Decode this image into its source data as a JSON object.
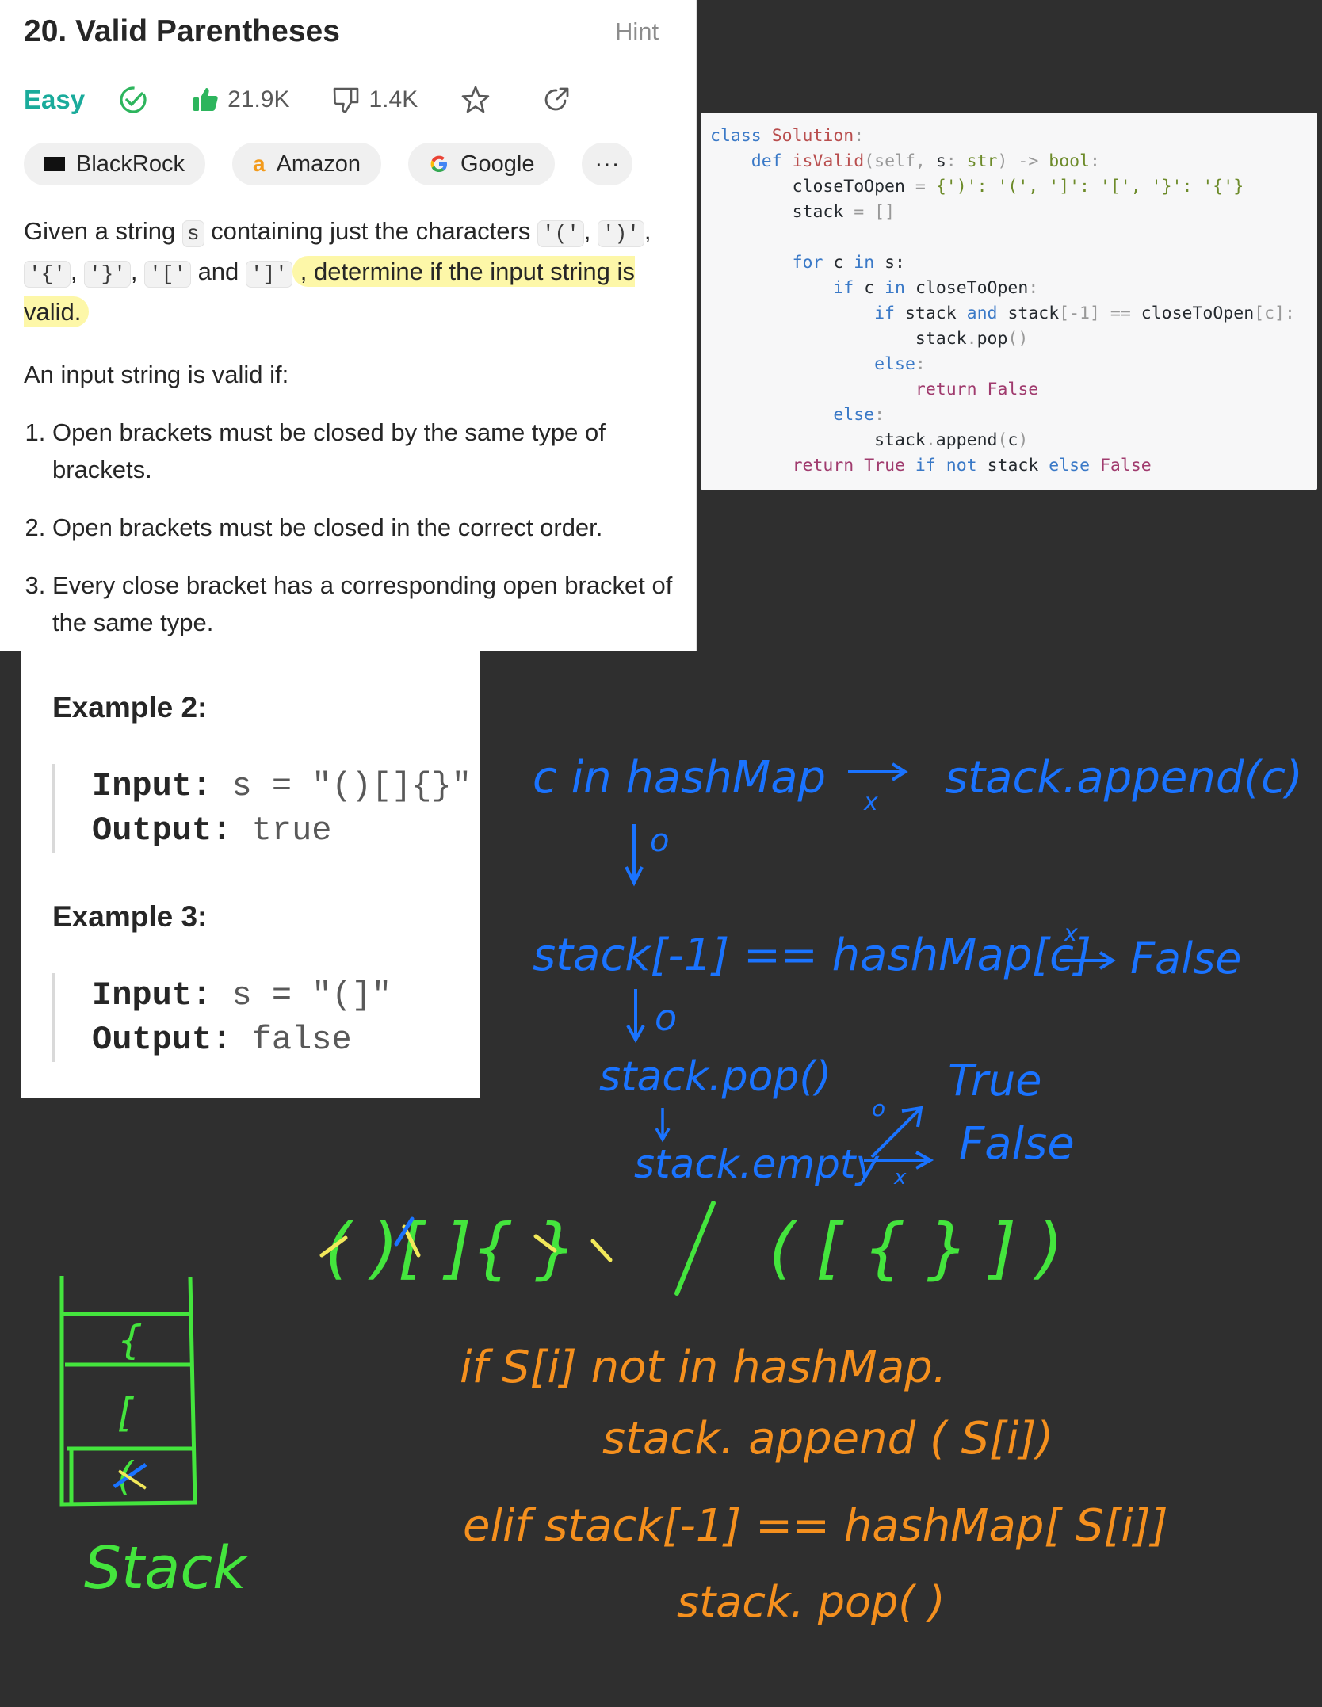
{
  "problem": {
    "title": "20. Valid Parentheses",
    "hint_label": "Hint",
    "difficulty": "Easy",
    "likes": "21.9K",
    "dislikes": "1.4K",
    "tags": [
      "BlackRock",
      "Amazon",
      "Google"
    ],
    "more_label": "···",
    "amazon_logo_letter": "a",
    "google_logo_letter": "G",
    "blackrock_logo_text": "BlackRock",
    "desc_given": "Given a string",
    "desc_s": "s",
    "desc_containing": "containing just the characters",
    "c1": "'('",
    "c2": "')'",
    "c3": "'{'",
    "c4": "'}'",
    "c5": "'['",
    "c6": "']'",
    "comma": ",",
    "and": "and",
    "desc_highlight": ", determine if the input string is valid.",
    "valid_if": "An input string is valid if:",
    "rules": [
      "Open brackets must be closed by the same type of brackets.",
      "Open brackets must be closed in the correct order.",
      "Every close bracket has a corresponding open bracket of the same type."
    ]
  },
  "examples": [
    {
      "title": "Example 2:",
      "input_label": "Input:",
      "input_value": "s = \"()[]{}\"",
      "output_label": "Output:",
      "output_value": "true"
    },
    {
      "title": "Example 3:",
      "input_label": "Input:",
      "input_value": "s = \"(]\"",
      "output_label": "Output:",
      "output_value": "false"
    }
  ],
  "code": {
    "l1a": "class",
    "l1b": "Solution",
    "l1c": ":",
    "l2a": "def",
    "l2b": "isValid",
    "l2c": "(self,",
    "l2d": "s",
    "l2e": ":",
    "l2f": "str",
    "l2g": ") ->",
    "l2h": "bool",
    "l2i": ":",
    "l3a": "closeToOpen",
    "l3b": "=",
    "l3c": "{')': '(', ']': '[', '}': '{'}",
    "l4a": "stack",
    "l4b": "=",
    "l4c": "[]",
    "l5a": "for",
    "l5b": "c",
    "l5c": "in",
    "l5d": "s:",
    "l6a": "if",
    "l6b": "c",
    "l6c": "in",
    "l6d": "closeToOpen",
    "l6e": ":",
    "l7a": "if",
    "l7b": "stack",
    "l7c": "and",
    "l7d": "stack",
    "l7e": "[-1]",
    "l7f": "==",
    "l7g": "closeToOpen",
    "l7h": "[c]:",
    "l8a": "stack",
    "l8b": ".",
    "l8c": "pop",
    "l8d": "()",
    "l9a": "else",
    "l9b": ":",
    "l10a": "return",
    "l10b": "False",
    "l11a": "else",
    "l11b": ":",
    "l12a": "stack",
    "l12b": ".",
    "l12c": "append",
    "l12d": "(",
    "l12e": "c",
    "l12f": ")",
    "l13a": "return",
    "l13b": "True",
    "l13c": "if",
    "l13d": "not",
    "l13e": "stack",
    "l13f": "else",
    "l13g": "False"
  },
  "notes": {
    "flow_1": "c in hashMap",
    "flow_1_result": "stack.append(c)",
    "x_mark": "x",
    "o_mark": "o",
    "flow_2": "stack[-1] == hashMap[c]",
    "flow_2_false": "False",
    "flow_3": "stack.pop()",
    "flow_4": "stack.empty",
    "true_label": "True",
    "false_label": "False",
    "bracket_example_left": "( )[ ]{ }",
    "slash": "/",
    "bracket_example_right": "( [ { } ] )",
    "pseudo_1": "if   S[i]  not in  hashMap.",
    "pseudo_2": "stack. append ( S[i])",
    "pseudo_3": "elif  stack[-1]  ==  hashMap[ S[i]]",
    "pseudo_4": "stack. pop(  )",
    "stack_items": [
      "{",
      "[",
      "("
    ],
    "stack_label": "Stack"
  },
  "colors": {
    "blue_ink": "#1a73ff",
    "green_ink": "#44e53d",
    "orange_ink": "#f5901e",
    "yellow_ink": "#f2e85a",
    "easy": "#1aab9b",
    "highlight": "#fdf7a8"
  }
}
